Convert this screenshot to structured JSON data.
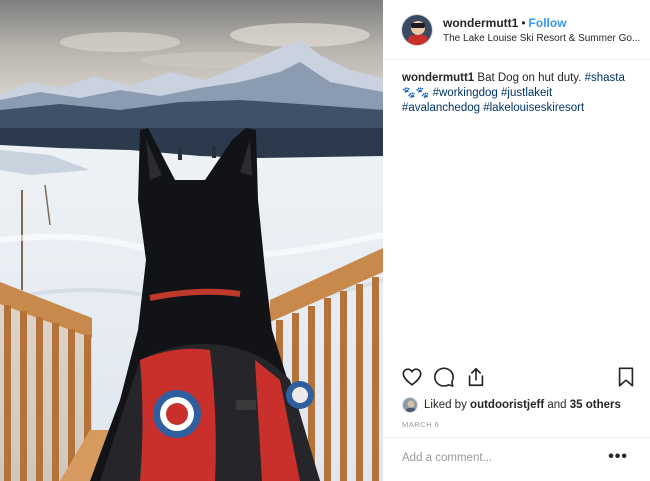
{
  "post": {
    "username": "wondermutt1",
    "separator": "•",
    "follow_label": "Follow",
    "location": "The Lake Louise Ski Resort & Summer Go...",
    "caption": {
      "username": "wondermutt1",
      "text": "Bat Dog on hut duty.",
      "tags": [
        "#shasta",
        "#workingdog",
        "#justlakeit",
        "#avalanchedog",
        "#lakelouiseskiresort"
      ],
      "emoji": "🐾🐾"
    },
    "actions": {
      "like_icon": "heart-icon",
      "comment_icon": "comment-icon",
      "share_icon": "share-icon",
      "save_icon": "bookmark-icon"
    },
    "likes": {
      "prefix": "Liked by",
      "user": "outdooristjeff",
      "and": "and",
      "others": "35 others"
    },
    "date": "MARCH 6",
    "comment_placeholder": "Add a comment...",
    "more_label": "•••"
  },
  "colors": {
    "link_blue": "#3897f0",
    "hashtag": "#003569",
    "muted": "#999999",
    "text": "#262626"
  }
}
